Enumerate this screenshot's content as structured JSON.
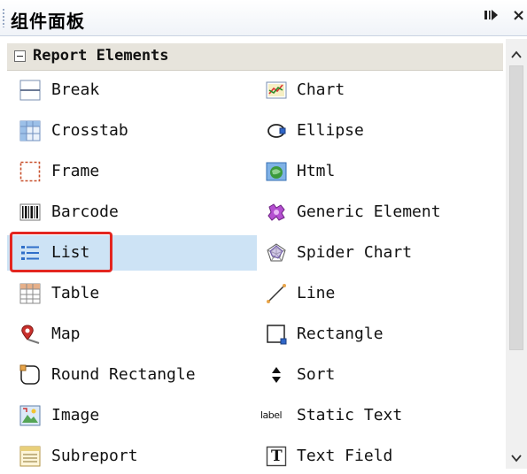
{
  "panel": {
    "title": "组件面板",
    "pin_icon": "pin-icon",
    "close_glyph": "×"
  },
  "section": {
    "label": "Report Elements",
    "expanded": true
  },
  "items": [
    {
      "label": "Break",
      "icon": "break-icon",
      "column": 1
    },
    {
      "label": "Chart",
      "icon": "chart-icon",
      "column": 2
    },
    {
      "label": "Crosstab",
      "icon": "crosstab-icon",
      "column": 1
    },
    {
      "label": "Ellipse",
      "icon": "ellipse-icon",
      "column": 2
    },
    {
      "label": "Frame",
      "icon": "frame-icon",
      "column": 1
    },
    {
      "label": "Html",
      "icon": "html-icon",
      "column": 2
    },
    {
      "label": "Barcode",
      "icon": "barcode-icon",
      "column": 1
    },
    {
      "label": "Generic Element",
      "icon": "generic-element-icon",
      "column": 2
    },
    {
      "label": "List",
      "icon": "list-icon",
      "column": 1,
      "selected": true
    },
    {
      "label": "Spider Chart",
      "icon": "spider-chart-icon",
      "column": 2
    },
    {
      "label": "Table",
      "icon": "table-icon",
      "column": 1
    },
    {
      "label": "Line",
      "icon": "line-icon",
      "column": 2
    },
    {
      "label": "Map",
      "icon": "map-icon",
      "column": 1
    },
    {
      "label": "Rectangle",
      "icon": "rectangle-icon",
      "column": 2
    },
    {
      "label": "Round Rectangle",
      "icon": "round-rectangle-icon",
      "column": 1
    },
    {
      "label": "Sort",
      "icon": "sort-icon",
      "column": 2
    },
    {
      "label": "Image",
      "icon": "image-icon",
      "column": 1
    },
    {
      "label": "Static Text",
      "icon": "static-text-icon",
      "column": 2,
      "icon_text": "label"
    },
    {
      "label": "Subreport",
      "icon": "subreport-icon",
      "column": 1
    },
    {
      "label": "Text Field",
      "icon": "text-field-icon",
      "column": 2,
      "icon_text": "T"
    }
  ],
  "colors": {
    "selection": "#cde3f5",
    "highlight_border": "#e32620",
    "section_bg": "#e7e4dc"
  }
}
